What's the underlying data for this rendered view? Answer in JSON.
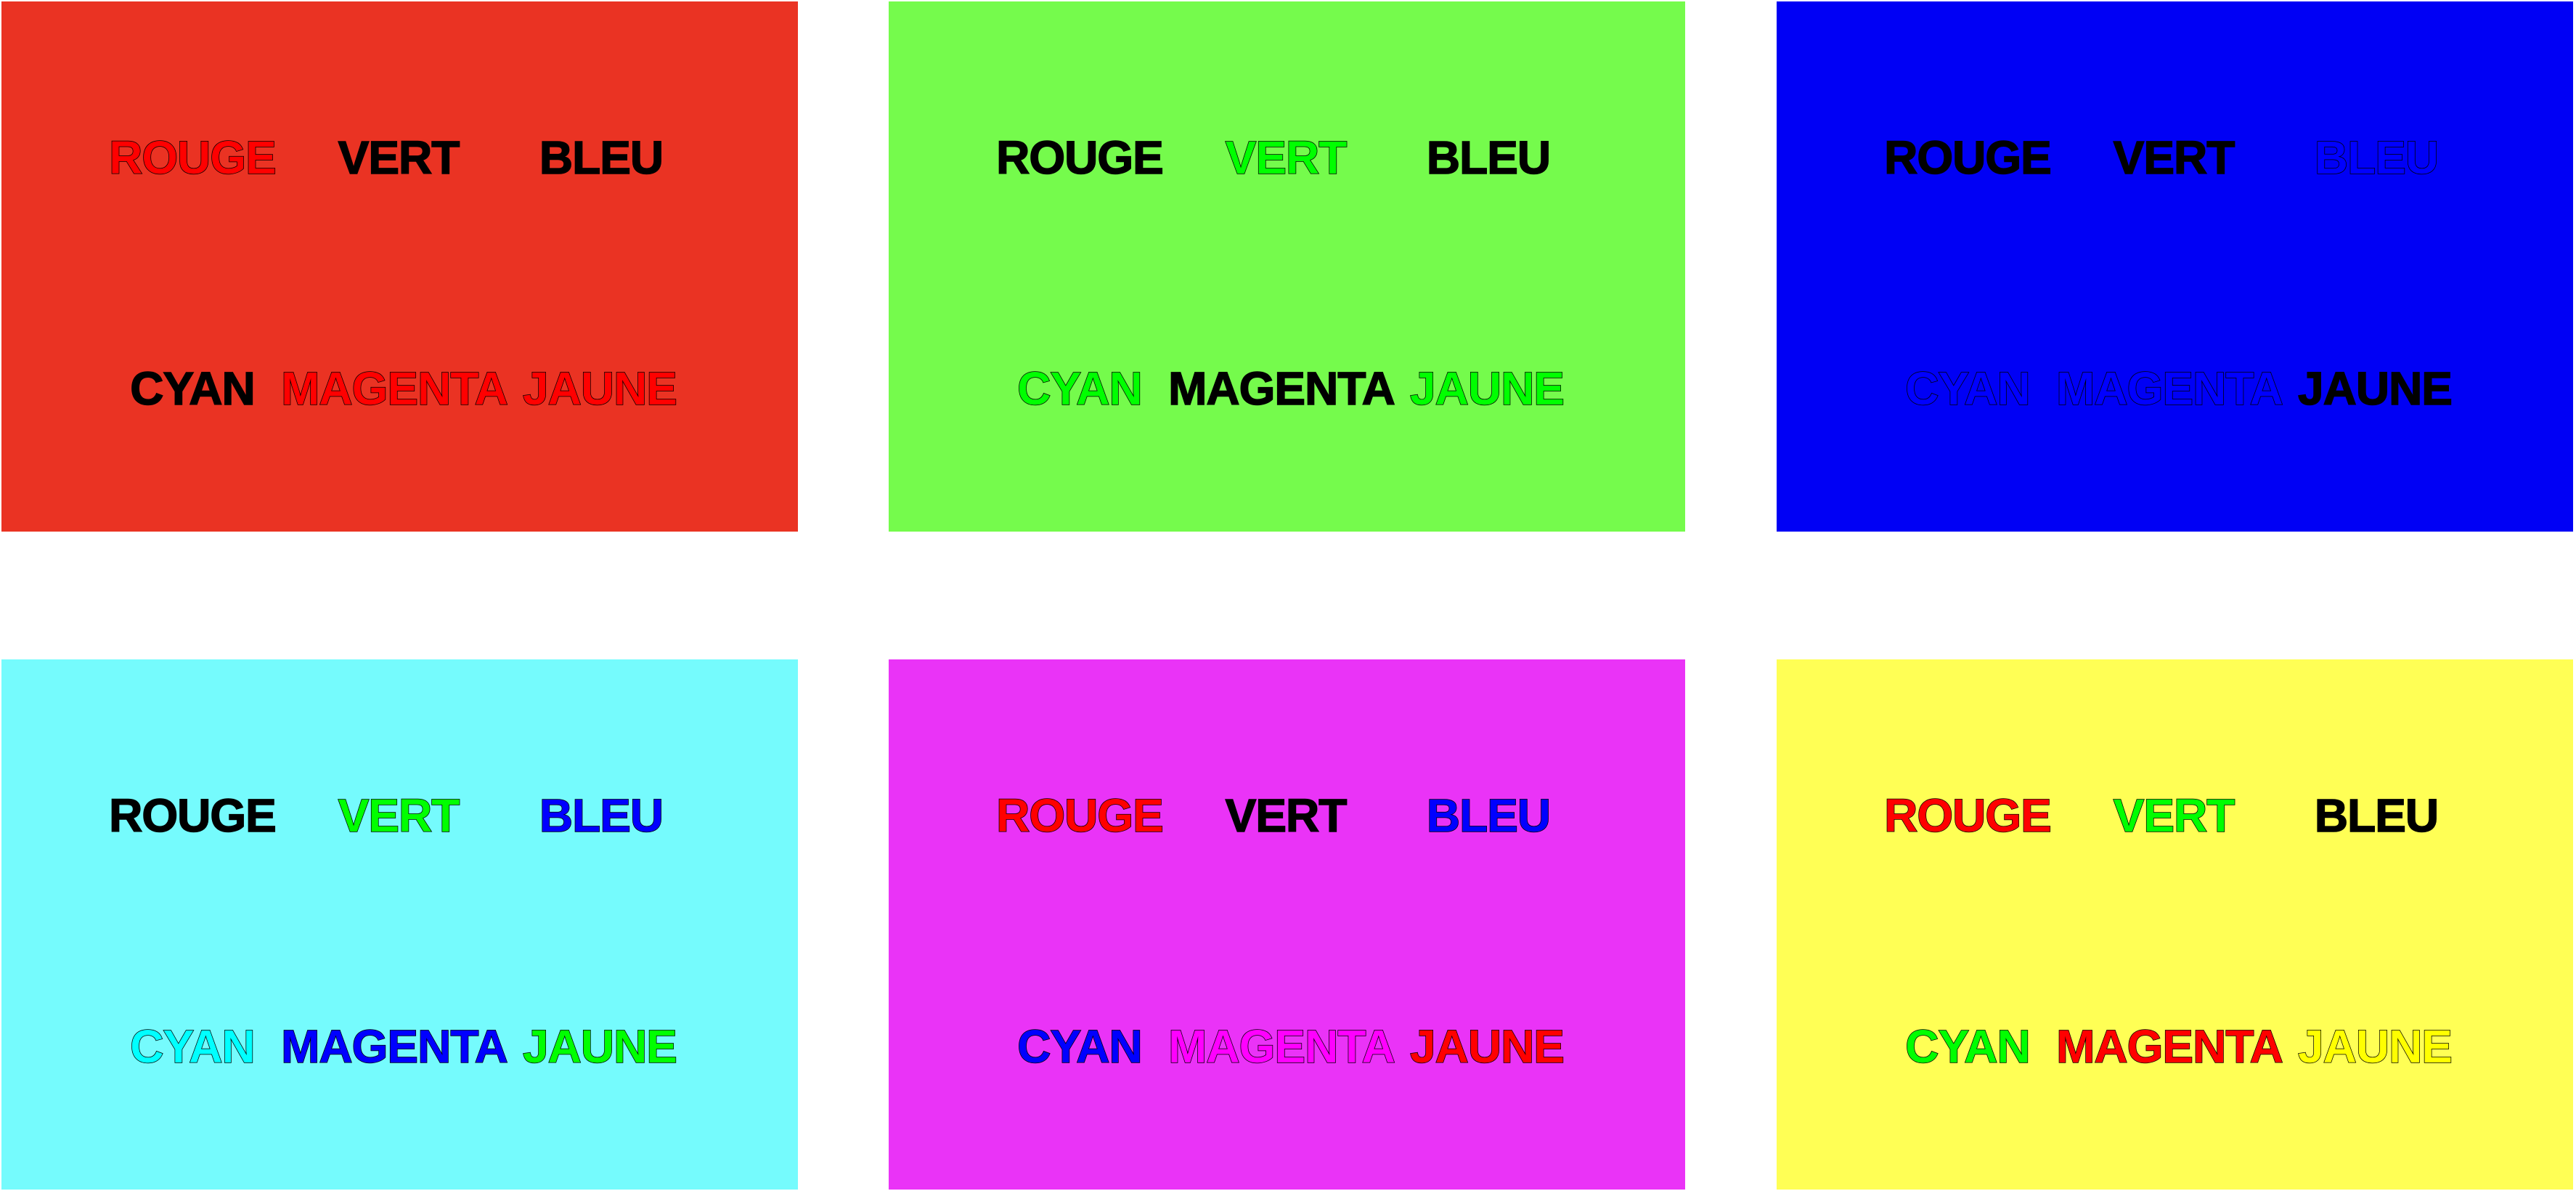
{
  "panels": [
    {
      "background": "#EA3323",
      "words": [
        {
          "text": "ROUGE",
          "color": "#FF0000"
        },
        {
          "text": "VERT",
          "color": "#000000"
        },
        {
          "text": "BLEU",
          "color": "#000000"
        },
        {
          "text": "CYAN",
          "color": "#000000"
        },
        {
          "text": "MAGENTA",
          "color": "#FF0000"
        },
        {
          "text": "JAUNE",
          "color": "#FF0000"
        }
      ]
    },
    {
      "background": "#75FB4C",
      "words": [
        {
          "text": "ROUGE",
          "color": "#000000"
        },
        {
          "text": "VERT",
          "color": "#00FF00"
        },
        {
          "text": "BLEU",
          "color": "#000000"
        },
        {
          "text": "CYAN",
          "color": "#00FF00"
        },
        {
          "text": "MAGENTA",
          "color": "#000000"
        },
        {
          "text": "JAUNE",
          "color": "#00FF00"
        }
      ]
    },
    {
      "background": "#0000F5",
      "words": [
        {
          "text": "ROUGE",
          "color": "#000000"
        },
        {
          "text": "VERT",
          "color": "#000000"
        },
        {
          "text": "BLEU",
          "color": "#0000FF"
        },
        {
          "text": "CYAN",
          "color": "#0000FF"
        },
        {
          "text": "MAGENTA",
          "color": "#0000FF"
        },
        {
          "text": "JAUNE",
          "color": "#000000"
        }
      ]
    },
    {
      "background": "#75FBFD",
      "words": [
        {
          "text": "ROUGE",
          "color": "#000000"
        },
        {
          "text": "VERT",
          "color": "#00FF00"
        },
        {
          "text": "BLEU",
          "color": "#0000FF"
        },
        {
          "text": "CYAN",
          "color": "#00FFFF"
        },
        {
          "text": "MAGENTA",
          "color": "#0000FF"
        },
        {
          "text": "JAUNE",
          "color": "#00FF00"
        }
      ]
    },
    {
      "background": "#EA33F7",
      "words": [
        {
          "text": "ROUGE",
          "color": "#FF0000"
        },
        {
          "text": "VERT",
          "color": "#000000"
        },
        {
          "text": "BLEU",
          "color": "#0000FF"
        },
        {
          "text": "CYAN",
          "color": "#0000FF"
        },
        {
          "text": "MAGENTA",
          "color": "#FF00FF"
        },
        {
          "text": "JAUNE",
          "color": "#FF0000"
        }
      ]
    },
    {
      "background": "#FFFF55",
      "words": [
        {
          "text": "ROUGE",
          "color": "#FF0000"
        },
        {
          "text": "VERT",
          "color": "#00FF00"
        },
        {
          "text": "BLEU",
          "color": "#000000"
        },
        {
          "text": "CYAN",
          "color": "#00FF00"
        },
        {
          "text": "MAGENTA",
          "color": "#FF0000"
        },
        {
          "text": "JAUNE",
          "color": "#FFFF00"
        }
      ]
    }
  ]
}
